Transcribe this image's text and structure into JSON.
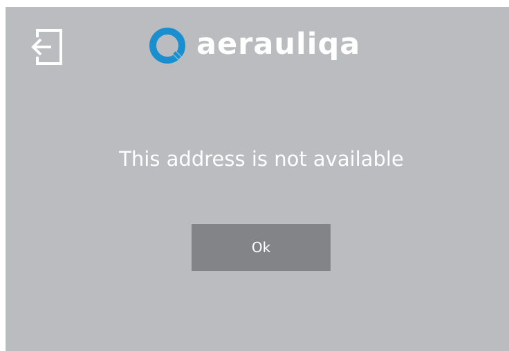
{
  "header": {
    "exit_icon": "exit-door-arrow-icon",
    "logo_text": "aerauliqa",
    "logo_icon": "aerauliqa-q-mark-icon"
  },
  "dialog": {
    "message": "This address is not available",
    "ok_label": "Ok"
  },
  "colors": {
    "background": "#bbbcc0",
    "button": "#838488",
    "text": "#ffffff",
    "logo_accent": "#1a8fd0"
  }
}
